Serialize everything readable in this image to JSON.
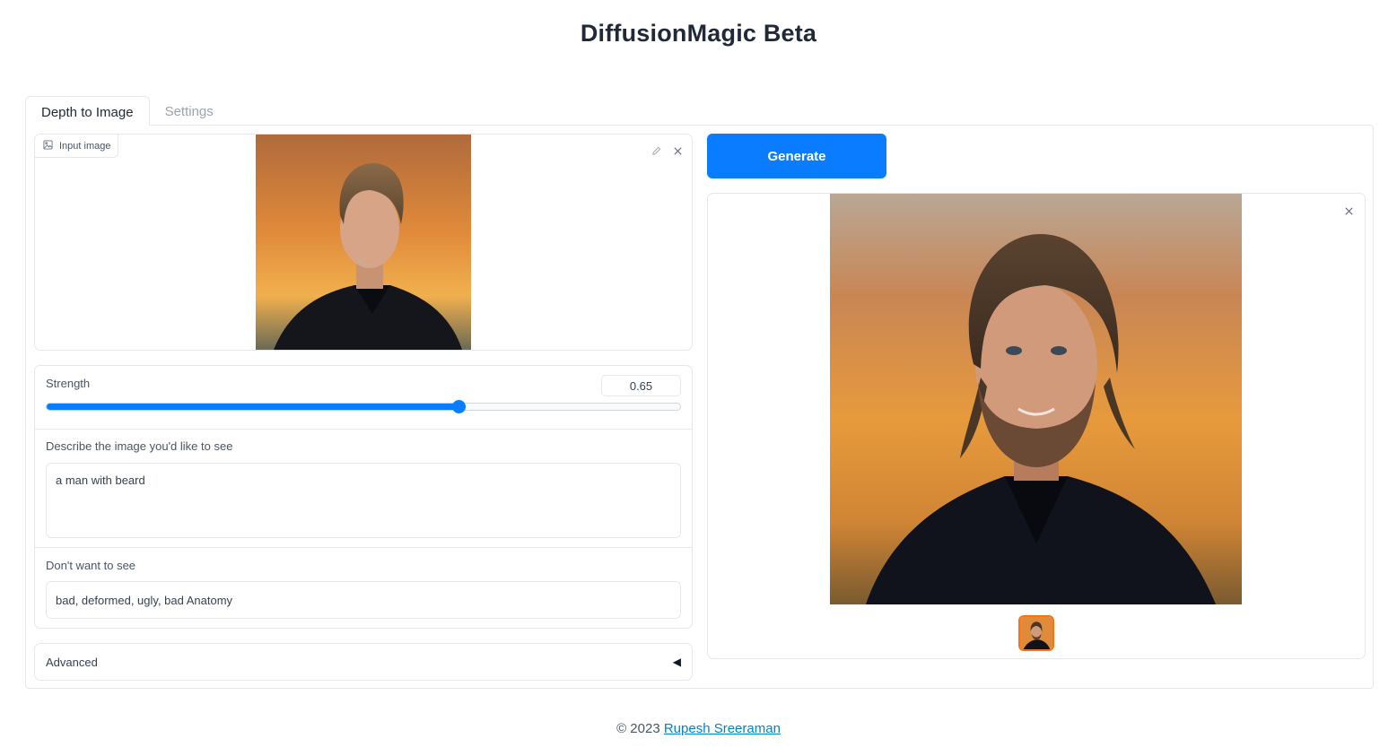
{
  "app": {
    "title": "DiffusionMagic Beta"
  },
  "tabs": [
    {
      "label": "Depth to Image",
      "active": true
    },
    {
      "label": "Settings",
      "active": false
    }
  ],
  "input_image": {
    "label": "Input image",
    "edit_icon": "pencil-icon",
    "clear_icon": "close-icon"
  },
  "strength": {
    "label": "Strength",
    "value": "0.65",
    "min": 0,
    "max": 1
  },
  "prompt": {
    "label": "Describe the image you'd like to see",
    "value": "a man with beard"
  },
  "negative_prompt": {
    "label": "Don't want to see",
    "value": "bad, deformed, ugly, bad Anatomy"
  },
  "advanced": {
    "label": "Advanced",
    "collapsed_icon": "triangle-left-icon"
  },
  "generate": {
    "label": "Generate"
  },
  "gallery": {
    "clear_icon": "close-icon",
    "thumbnail_count": 1
  },
  "footer": {
    "copyright": "© 2023",
    "author": "Rupesh Sreeraman"
  },
  "colors": {
    "accent": "#0a7cff",
    "thumb_border": "#f97316",
    "link": "#0284c7"
  }
}
